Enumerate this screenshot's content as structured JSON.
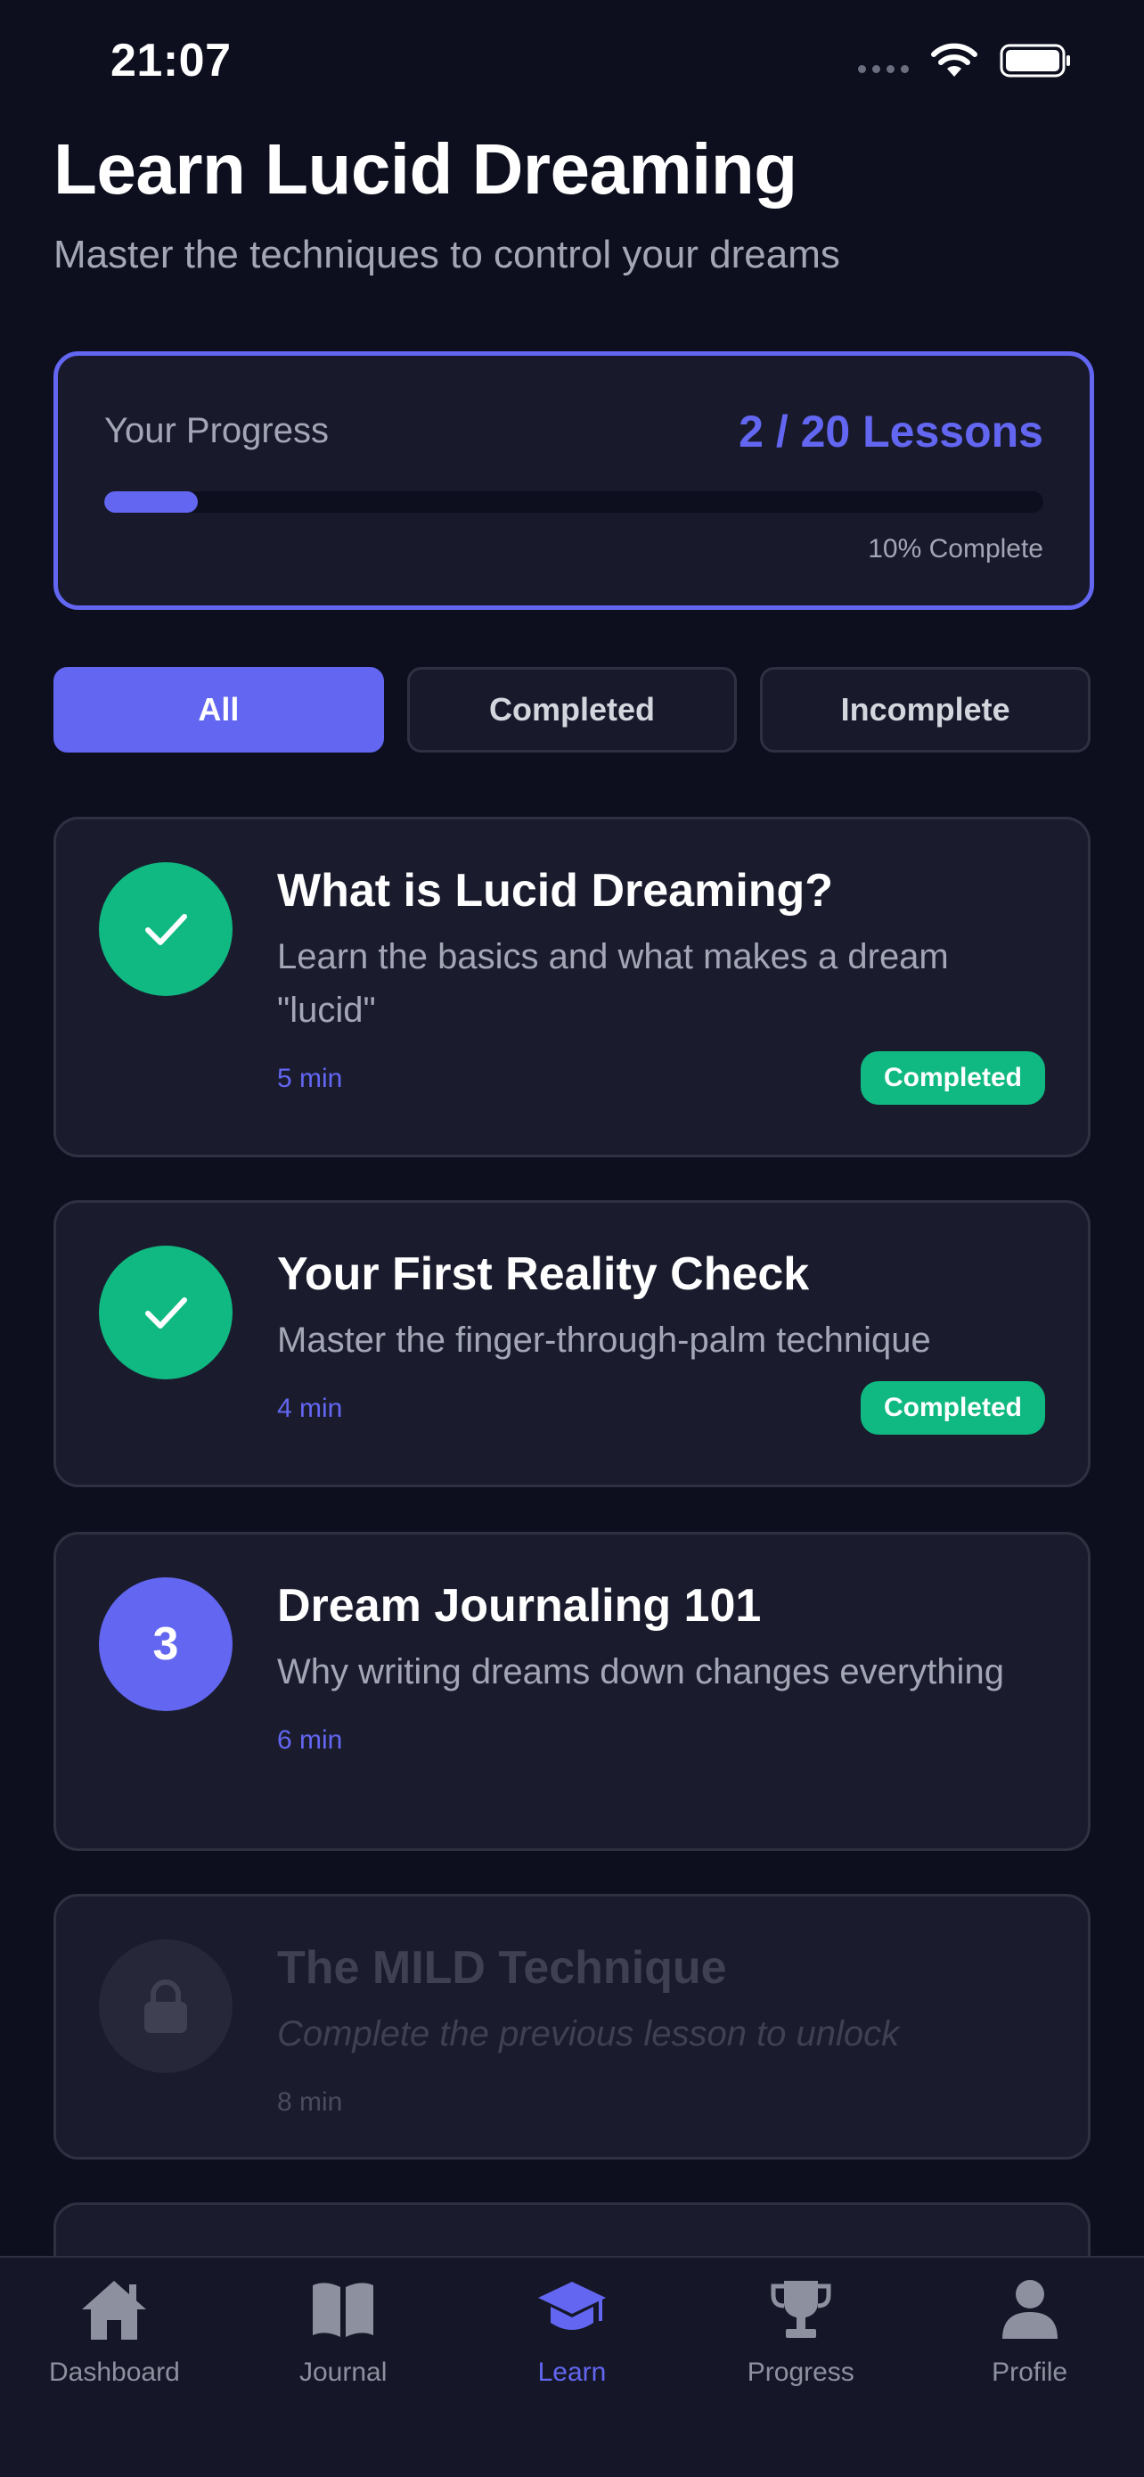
{
  "status_bar": {
    "time": "21:07"
  },
  "header": {
    "title": "Learn Lucid Dreaming",
    "subtitle": "Master the techniques to control your dreams"
  },
  "progress": {
    "label": "Your Progress",
    "count": "2 / 20 Lessons",
    "percent_text": "10% Complete",
    "fraction": 0.1
  },
  "filters": {
    "all": "All",
    "completed": "Completed",
    "incomplete": "Incomplete",
    "active": "All"
  },
  "lessons": [
    {
      "title": "What is Lucid Dreaming?",
      "description": "Learn the basics and what makes a dream \"lucid\"",
      "duration": "5 min",
      "status": "Completed",
      "icon": "check-icon"
    },
    {
      "title": "Your First Reality Check",
      "description": "Master the finger-through-palm technique",
      "duration": "4 min",
      "status": "Completed",
      "icon": "check-icon"
    },
    {
      "title": "Dream Journaling 101",
      "description": "Why writing dreams down changes everything",
      "duration": "6 min",
      "number": "3",
      "icon": "number"
    },
    {
      "title": "The MILD Technique",
      "description": "Complete the previous lesson to unlock",
      "duration": "8 min",
      "icon": "lock-icon"
    }
  ],
  "tabs": [
    {
      "label": "Dashboard",
      "icon": "home-icon"
    },
    {
      "label": "Journal",
      "icon": "book-icon"
    },
    {
      "label": "Learn",
      "icon": "graduation-cap-icon"
    },
    {
      "label": "Progress",
      "icon": "trophy-icon"
    },
    {
      "label": "Profile",
      "icon": "user-icon"
    }
  ],
  "colors": {
    "background": "#0d0f1f",
    "accent": "#6366f1",
    "success": "#10b981",
    "card": "#1a1c2e"
  }
}
